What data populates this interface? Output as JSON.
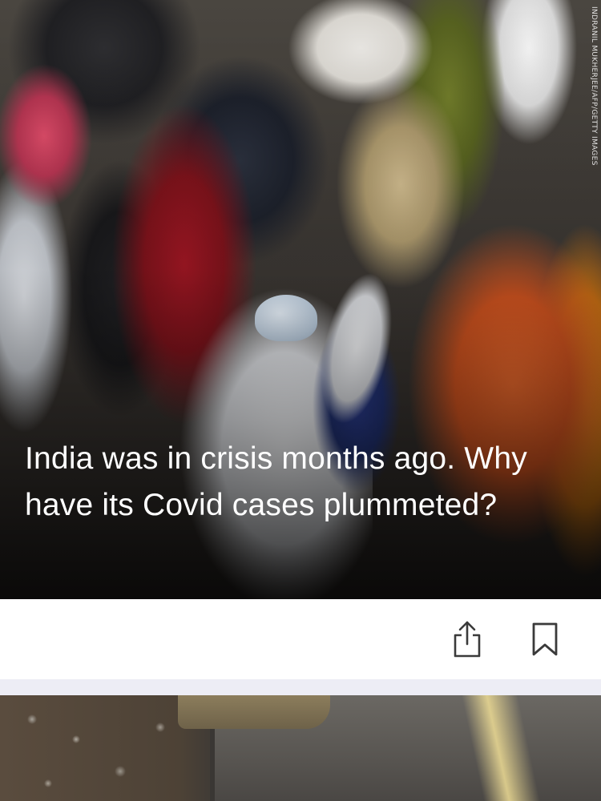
{
  "story": {
    "headline": "India was in crisis months ago. Why have its Covid cases plummeted?",
    "photo_credit": "INDRANIL MUKHERJEE/AFP/GETTY IMAGES"
  },
  "actions": {
    "share_icon": "share-icon",
    "bookmark_icon": "bookmark-icon"
  },
  "colors": {
    "headline_text": "#ffffff",
    "icon_stroke": "#3a3a3a",
    "divider": "#ededf5",
    "action_bar_bg": "#ffffff"
  }
}
